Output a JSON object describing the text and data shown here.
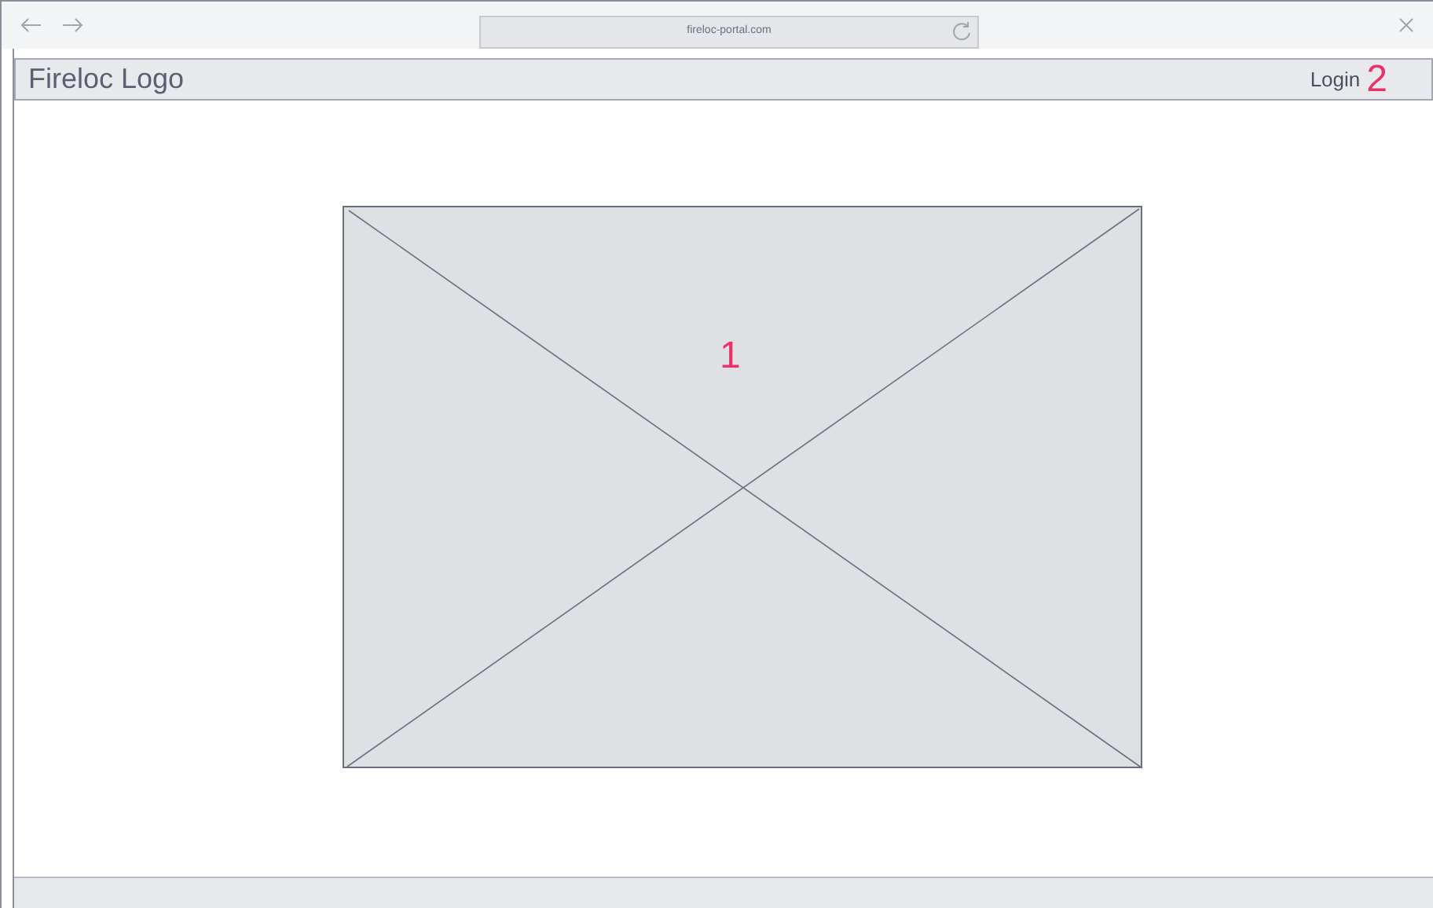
{
  "browser": {
    "url": "fireloc-portal.com"
  },
  "header": {
    "logo": "Fireloc Logo",
    "login": "Login",
    "login_marker": "2"
  },
  "main": {
    "placeholder_marker": "1"
  }
}
